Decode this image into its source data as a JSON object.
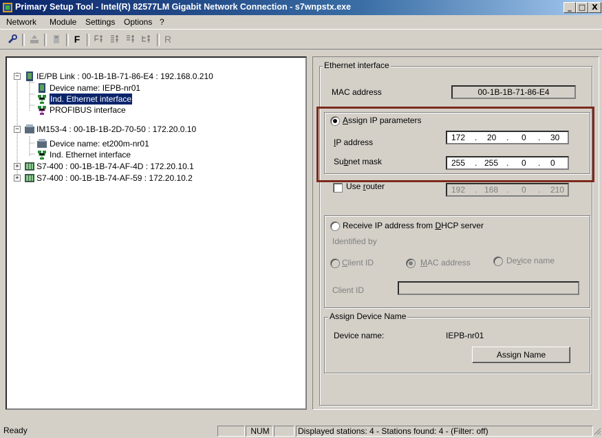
{
  "window": {
    "title": "Primary Setup Tool - Intel(R) 82577LM Gigabit Network Connection - s7wnpstx.exe",
    "minimize": "_",
    "maximize": "□",
    "close": "X"
  },
  "menu": [
    "Network",
    "Module",
    "Settings",
    "Options",
    "?"
  ],
  "toolbar": {
    "f_label": "F",
    "r_label": "R"
  },
  "tree": [
    {
      "label": "IE/PB Link : 00-1B-1B-71-86-E4 : 192.168.0.210"
    },
    {
      "label": "Device name: IEPB-nr01"
    },
    {
      "label": "Ind. Ethernet interface"
    },
    {
      "label": "PROFIBUS interface"
    },
    {
      "label": "IM153-4 : 00-1B-1B-2D-70-50 : 172.20.0.10"
    },
    {
      "label": "Device name: et200m-nr01"
    },
    {
      "label": "Ind. Ethernet interface"
    },
    {
      "label": "S7-400 : 00-1B-1B-74-AF-4D : 172.20.10.1"
    },
    {
      "label": "S7-400 : 00-1B-1B-74-AF-59 : 172.20.10.2"
    }
  ],
  "ethernet": {
    "group_title": "Ethernet interface",
    "mac_label": "MAC address",
    "mac_value": "00-1B-1B-71-86-E4",
    "assign_ip_label_pre": "",
    "assign_ip_label_u": "A",
    "assign_ip_label_post": "ssign IP parameters",
    "ip_label_u": "I",
    "ip_label_post": "P address",
    "ip_octets": [
      "172",
      "20",
      "0",
      "30"
    ],
    "subnet_label_pre": "Su",
    "subnet_label_u": "b",
    "subnet_label_post": "net mask",
    "subnet_octets": [
      "255",
      "255",
      "0",
      "0"
    ],
    "router_label_pre": "Use ",
    "router_label_u": "r",
    "router_label_post": "outer",
    "router_octets": [
      "192",
      "168",
      "0",
      "210"
    ],
    "dhcp_label_pre": "Receive IP address from ",
    "dhcp_label_u": "D",
    "dhcp_label_post": "HCP server",
    "identified_by": "Identified by",
    "client_id_opt_u": "C",
    "client_id_opt_post": "lient ID",
    "mac_opt_u": "M",
    "mac_opt_post": "AC address",
    "devname_opt_pre": "De",
    "devname_opt_u": "v",
    "devname_opt_post": "ice name",
    "client_id_label": "Client ID",
    "client_id_value": ""
  },
  "device_name": {
    "group_title": "Assign Device Name",
    "label": "Device name:",
    "value": "IEPB-nr01",
    "button": "Assign Name"
  },
  "status": {
    "ready": "Ready",
    "num": "NUM",
    "stations": "Displayed stations: 4 - Stations found: 4 - (Filter: off)"
  },
  "colors": {
    "highlight_border": "#7b2a1e",
    "titlebar": "#0a246a",
    "selection": "#0a246a"
  }
}
